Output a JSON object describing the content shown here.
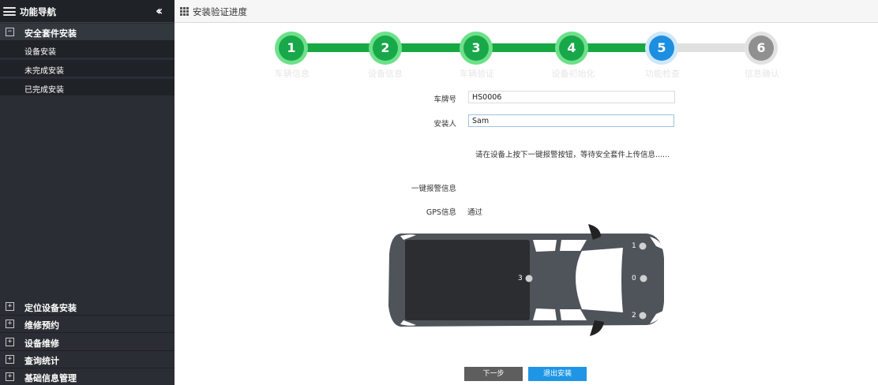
{
  "sidebar": {
    "title": "功能导航",
    "collapse_icon": "double-chevron-left-icon",
    "groups_top": [
      {
        "label": "安全套件安装",
        "expanded": true,
        "toggle": "−"
      }
    ],
    "subitems": [
      {
        "label": "设备安装"
      },
      {
        "label": "未完成安装"
      },
      {
        "label": "已完成安装"
      }
    ],
    "groups_bottom": [
      {
        "label": "定位设备安装",
        "toggle": "+"
      },
      {
        "label": "维修预约",
        "toggle": "+"
      },
      {
        "label": "设备维修",
        "toggle": "+"
      },
      {
        "label": "查询统计",
        "toggle": "+"
      },
      {
        "label": "基础信息管理",
        "toggle": "+"
      }
    ]
  },
  "topbar": {
    "title": "安装验证进度",
    "icon": "grid-icon"
  },
  "steps": [
    {
      "num": "1",
      "label": "车辆信息",
      "state": "done"
    },
    {
      "num": "2",
      "label": "设备信息",
      "state": "done"
    },
    {
      "num": "3",
      "label": "车辆验证",
      "state": "done"
    },
    {
      "num": "4",
      "label": "设备初始化",
      "state": "done"
    },
    {
      "num": "5",
      "label": "功能检查",
      "state": "active"
    },
    {
      "num": "6",
      "label": "信息确认",
      "state": "todo"
    }
  ],
  "colors": {
    "done": "#18a84a",
    "active": "#1d8fe0",
    "todo": "#909090",
    "line_done": "#17a843",
    "line_todo": "#e0e0e0"
  },
  "form": {
    "plate_label": "车牌号",
    "plate_value": "HS0006",
    "installer_label": "安装人",
    "installer_value": "Sam",
    "hint": "请在设备上按下一键报警按钮，等待安全套件上传信息......",
    "alarm_label": "一键报警信息",
    "alarm_value": "",
    "gps_label": "GPS信息",
    "gps_value": "通过"
  },
  "sensors": {
    "s0": "0",
    "s1": "1",
    "s2": "2",
    "s3": "3"
  },
  "buttons": {
    "next": "下一步",
    "exit": "退出安装"
  }
}
